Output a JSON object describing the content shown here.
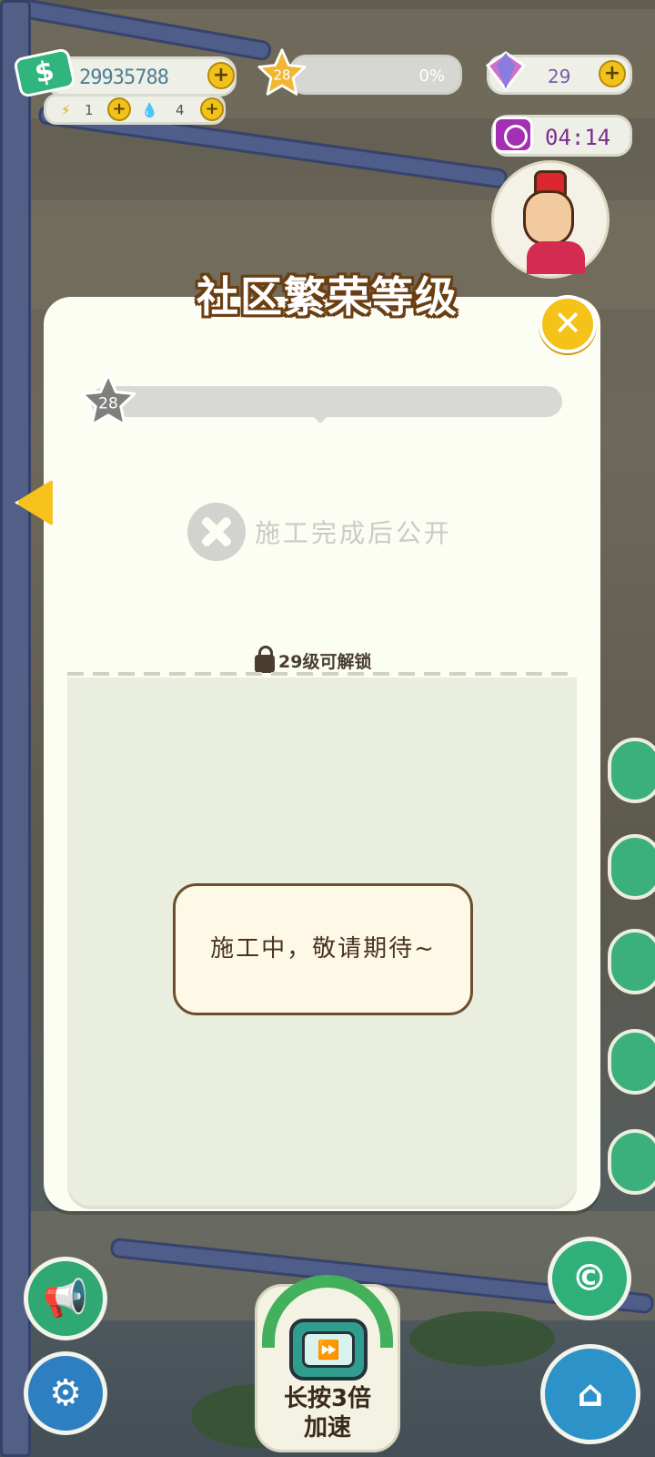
{
  "hud": {
    "money": "29935788",
    "energy": "1",
    "water": "4",
    "level": "28",
    "progress_percent": "0%",
    "gems": "29",
    "timer": "04:14"
  },
  "modal": {
    "title": "社区繁荣等级",
    "current_level": "28",
    "progress": 0,
    "reveal_text": "施工完成后公开",
    "unlock_text": "29级可解锁",
    "construction_text": "施工中，敬请期待~"
  },
  "bottom": {
    "speed_label_line1": "长按3倍",
    "speed_label_line2": "加速"
  },
  "icons": {
    "cash": "$",
    "plus": "+",
    "close": "✕",
    "tv": "⏩"
  },
  "colors": {
    "modal_bg": "#fcfdf3",
    "accent_yellow": "#f5c21a",
    "title_stroke": "#6b3e12"
  }
}
